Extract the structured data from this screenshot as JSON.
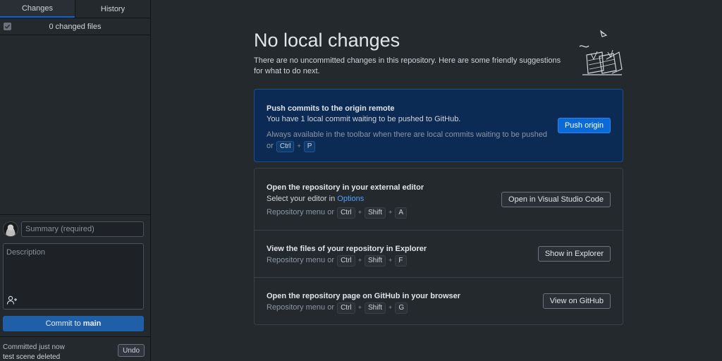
{
  "sidebar": {
    "tabs": [
      {
        "label": "Changes"
      },
      {
        "label": "History"
      }
    ],
    "changed_files_label": "0 changed files",
    "summary_placeholder": "Summary (required)",
    "description_placeholder": "Description",
    "commit_button": {
      "prefix": "Commit to",
      "branch": "main"
    },
    "last_commit": {
      "status": "Committed just now",
      "message": "test scene deleted",
      "undo_label": "Undo"
    }
  },
  "main": {
    "title": "No local changes",
    "subtitle": "There are no uncommitted changes in this repository. Here are some friendly suggestions for what to do next.",
    "push": {
      "title": "Push commits to the origin remote",
      "description": "You have 1 local commit waiting to be pushed to GitHub.",
      "hint": "Always available in the toolbar when there are local commits waiting to be pushed or",
      "shortcut": [
        "Ctrl",
        "P"
      ],
      "button": "Push origin"
    },
    "editor": {
      "title": "Open the repository in your external editor",
      "description_prefix": "Select your editor in",
      "description_link": "Options",
      "hint": "Repository menu or",
      "shortcut": [
        "Ctrl",
        "Shift",
        "A"
      ],
      "button": "Open in Visual Studio Code"
    },
    "explorer": {
      "title": "View the files of your repository in Explorer",
      "hint": "Repository menu or",
      "shortcut": [
        "Ctrl",
        "Shift",
        "F"
      ],
      "button": "Show in Explorer"
    },
    "github": {
      "title": "Open the repository page on GitHub in your browser",
      "hint": "Repository menu or",
      "shortcut": [
        "Ctrl",
        "Shift",
        "G"
      ],
      "button": "View on GitHub"
    },
    "shortcut_separator": "+"
  },
  "colors": {
    "background": "#24292e",
    "accent": "#0366d6",
    "push_card": "#0b2b55",
    "link": "#4ea1ff"
  },
  "icons": [
    "checkbox-icon",
    "avatar",
    "add-coauthor-icon",
    "empty-state-illustration"
  ]
}
